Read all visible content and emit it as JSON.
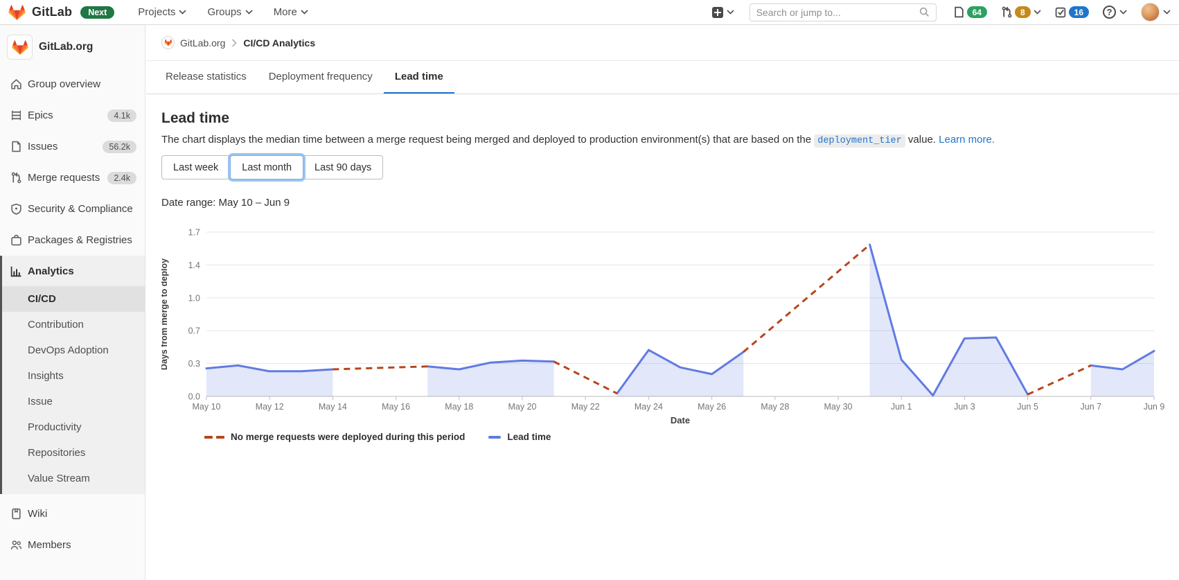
{
  "navbar": {
    "brand": "GitLab",
    "next_badge": "Next",
    "menus": [
      {
        "label": "Projects"
      },
      {
        "label": "Groups"
      },
      {
        "label": "More"
      }
    ],
    "search": {
      "placeholder": "Search or jump to..."
    },
    "counters": {
      "issues": "64",
      "merge_requests": "8",
      "todos": "16"
    }
  },
  "sidebar": {
    "group": {
      "name": "GitLab.org"
    },
    "items": [
      {
        "label": "Group overview"
      },
      {
        "label": "Epics",
        "badge": "4.1k"
      },
      {
        "label": "Issues",
        "badge": "56.2k"
      },
      {
        "label": "Merge requests",
        "badge": "2.4k"
      },
      {
        "label": "Security & Compliance"
      },
      {
        "label": "Packages & Registries"
      }
    ],
    "analytics": {
      "label": "Analytics",
      "children": [
        {
          "label": "CI/CD"
        },
        {
          "label": "Contribution"
        },
        {
          "label": "DevOps Adoption"
        },
        {
          "label": "Insights"
        },
        {
          "label": "Issue"
        },
        {
          "label": "Productivity"
        },
        {
          "label": "Repositories"
        },
        {
          "label": "Value Stream"
        }
      ],
      "active_child": "CI/CD"
    },
    "wiki": {
      "label": "Wiki"
    },
    "members": {
      "label": "Members"
    }
  },
  "breadcrumb": {
    "group": "GitLab.org",
    "page": "CI/CD Analytics"
  },
  "tabs": [
    {
      "label": "Release statistics"
    },
    {
      "label": "Deployment frequency"
    },
    {
      "label": "Lead time",
      "active": true
    }
  ],
  "content": {
    "title": "Lead time",
    "description": {
      "before": "The chart displays the median time between a merge request being merged and deployed to production environment(s) that are based on the ",
      "code": "deployment_tier",
      "after": " value. ",
      "link": "Learn more."
    },
    "range_buttons": [
      {
        "label": "Last week"
      },
      {
        "label": "Last month",
        "selected": true
      },
      {
        "label": "Last 90 days"
      }
    ],
    "date_range": "Date range: May 10 – Jun 9"
  },
  "chart_data": {
    "type": "area",
    "x": [
      "May 10",
      "May 11",
      "May 12",
      "May 13",
      "May 14",
      "May 15",
      "May 16",
      "May 17",
      "May 18",
      "May 19",
      "May 20",
      "May 21",
      "May 22",
      "May 23",
      "May 24",
      "May 25",
      "May 26",
      "May 27",
      "May 28",
      "May 29",
      "May 30",
      "May 31",
      "Jun 1",
      "Jun 2",
      "Jun 3",
      "Jun 4",
      "Jun 5",
      "Jun 6",
      "Jun 7",
      "Jun 8",
      "Jun 9"
    ],
    "x_tick_every": 2,
    "series": [
      {
        "name": "Lead time",
        "values": [
          0.29,
          0.32,
          0.26,
          0.26,
          0.28,
          null,
          null,
          0.31,
          0.28,
          0.35,
          0.37,
          0.36,
          null,
          0.03,
          0.48,
          0.3,
          0.23,
          0.46,
          null,
          null,
          null,
          1.57,
          0.38,
          0.01,
          0.6,
          0.61,
          0.02,
          null,
          0.32,
          0.28,
          0.47
        ]
      }
    ],
    "gaps_note": "null values are periods with no deployed merge requests, drawn as dashed connectors",
    "ylabel": "Days from merge to deploy",
    "xlabel": "Date",
    "ylim": [
      0,
      1.7
    ],
    "yticks": [
      {
        "value": 0,
        "label": "0.0"
      },
      {
        "value": 0.34,
        "label": "0.3"
      },
      {
        "value": 0.68,
        "label": "0.7"
      },
      {
        "value": 1.02,
        "label": "1.0"
      },
      {
        "value": 1.36,
        "label": "1.4"
      },
      {
        "value": 1.7,
        "label": "1.7"
      }
    ],
    "grid": true,
    "legend_position": "bottom-left",
    "legend": [
      {
        "label": "No merge requests were deployed during this period",
        "type": "dashed"
      },
      {
        "label": "Lead time",
        "type": "line"
      }
    ],
    "colors": {
      "line": "#617ae2",
      "fill": "rgba(97,122,226,0.18)",
      "gap": "#b5461b",
      "gridline": "#e5e5e5",
      "axis": "#bdbdbd",
      "tick_text": "#757575",
      "axis_title": "#3d3d3d"
    }
  }
}
